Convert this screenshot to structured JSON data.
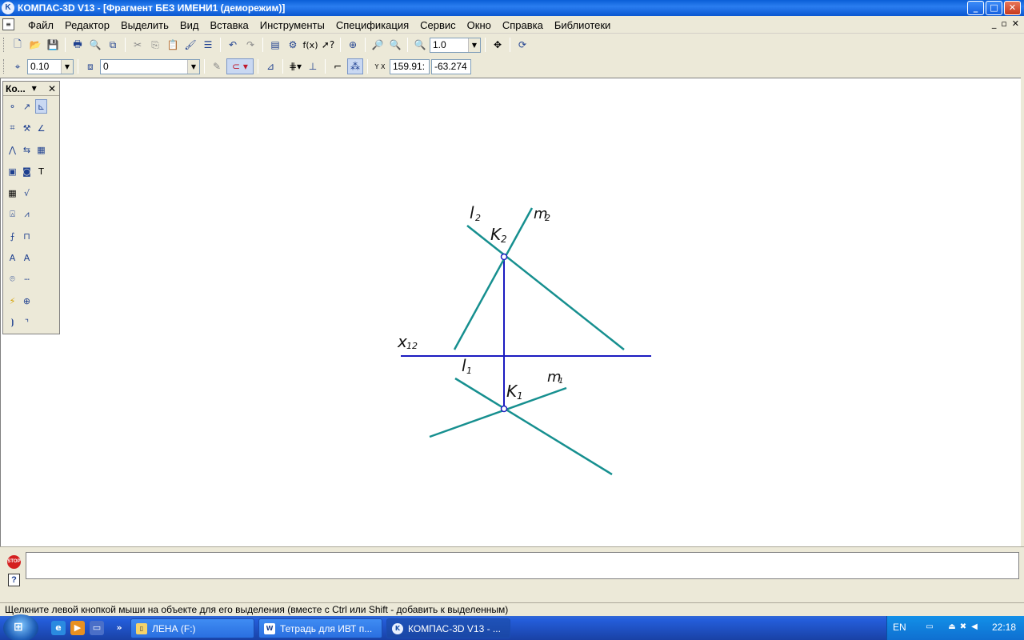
{
  "window": {
    "title": "КОМПАС-3D V13 - [Фрагмент БЕЗ ИМЕНИ1 (деморежим)]",
    "minimize": "_",
    "maximize": "□",
    "close": "✕",
    "mdi_minimize": "_",
    "mdi_restore": "▫",
    "mdi_close": "✕"
  },
  "menu": {
    "items": [
      "Файл",
      "Редактор",
      "Выделить",
      "Вид",
      "Вставка",
      "Инструменты",
      "Спецификация",
      "Сервис",
      "Окно",
      "Справка",
      "Библиотеки"
    ]
  },
  "toolbar_standard": {
    "zoom_value": "1.0",
    "fx_label": "f(x)"
  },
  "toolbar_current_state": {
    "step_value": "0.10",
    "layer_value": "0",
    "coord_label": "Y X",
    "x_value": "159.91:",
    "y_value": "-63.274"
  },
  "compact_panel": {
    "title": "Ко...",
    "close": "✕"
  },
  "drawing": {
    "labels": {
      "l2": "l",
      "l2_sub": "2",
      "m2": "m",
      "m2_sub": "2",
      "k2": "K",
      "k2_sub": "2",
      "x12": "x",
      "x12_sub": "12",
      "l1": "l",
      "l1_sub": "1",
      "m1": "m",
      "m1_sub": "1",
      "k1": "K",
      "k1_sub": "1"
    },
    "colors": {
      "line_color": "#168f8f",
      "axis_color": "#1c1cc0",
      "point_color": "#1c1cc0"
    }
  },
  "command": {
    "stop_label": "STOP",
    "help_label": "?"
  },
  "status": {
    "text": "Щелкните левой кнопкой мыши на объекте для его выделения (вместе с Ctrl или Shift - добавить к выделенным)"
  },
  "taskbar": {
    "overflow": "»",
    "tasks": [
      {
        "label": "ЛЕНА (F:)",
        "icon": "folder-icon"
      },
      {
        "label": "Тетрадь для ИВТ п...",
        "icon": "word-icon"
      },
      {
        "label": "КОМПАС-3D V13 - ...",
        "icon": "kompas-icon"
      }
    ],
    "lang": "EN",
    "clock": "22:18"
  }
}
